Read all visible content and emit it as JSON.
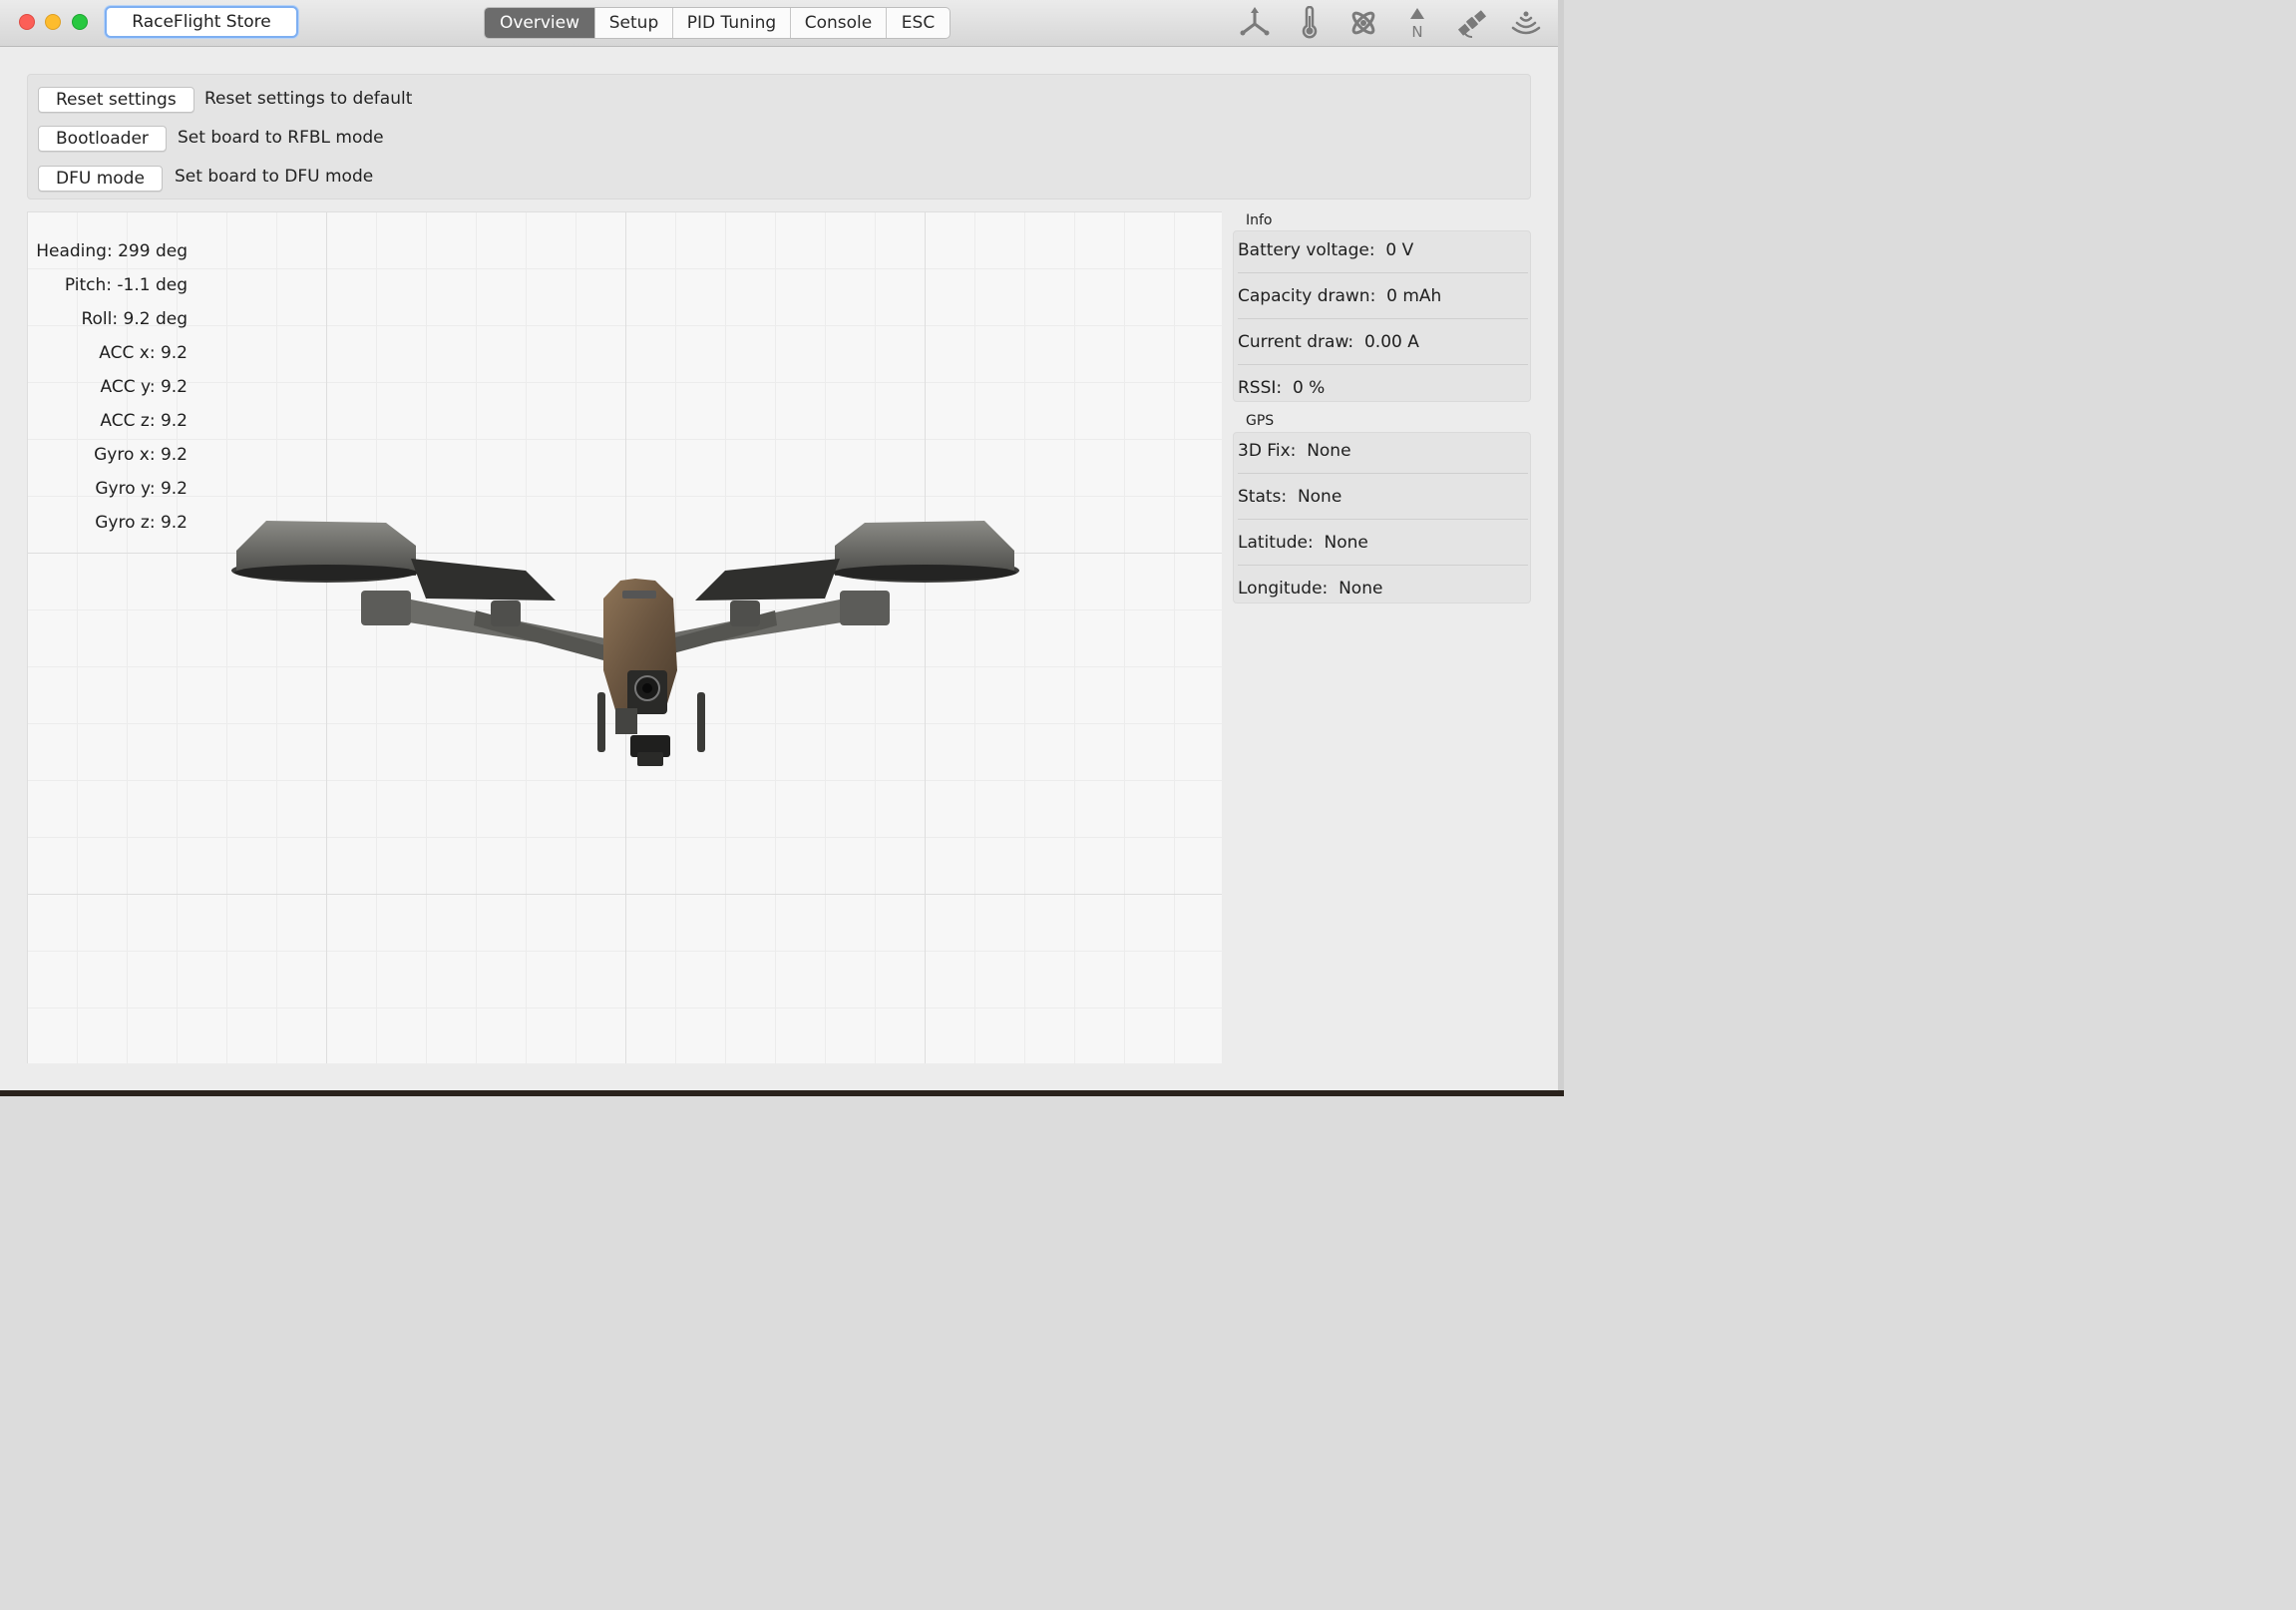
{
  "window": {
    "store_button": "RaceFlight Store",
    "tabs": [
      {
        "label": "Overview",
        "active": true
      },
      {
        "label": "Setup",
        "active": false
      },
      {
        "label": "PID Tuning",
        "active": false
      },
      {
        "label": "Console",
        "active": false
      },
      {
        "label": "ESC",
        "active": false
      }
    ],
    "toolbar_icons": [
      "axes-icon",
      "thermometer-icon",
      "gyro-icon",
      "compass-icon",
      "satellite-icon",
      "signal-icon"
    ],
    "compass_label": "N"
  },
  "commands": [
    {
      "button": "Reset settings",
      "description": "Reset settings to default"
    },
    {
      "button": "Bootloader",
      "description": "Set board to RFBL mode"
    },
    {
      "button": "DFU mode",
      "description": "Set board to DFU mode"
    }
  ],
  "readouts": [
    "Heading: 299 deg",
    "Pitch: -1.1 deg",
    "Roll: 9.2 deg",
    "ACC x: 9.2",
    "ACC y: 9.2",
    "ACC z: 9.2",
    "Gyro x: 9.2",
    "Gyro y: 9.2",
    "Gyro z: 9.2"
  ],
  "info": {
    "label": "Info",
    "rows": [
      {
        "label": "Battery voltage:",
        "value": "0 V"
      },
      {
        "label": "Capacity drawn:",
        "value": "0 mAh"
      },
      {
        "label": "Current draw:",
        "value": "0.00 A"
      },
      {
        "label": "RSSI:",
        "value": "0 %"
      }
    ]
  },
  "gps": {
    "label": "GPS",
    "rows": [
      {
        "label": "3D Fix:",
        "value": "None"
      },
      {
        "label": "Stats:",
        "value": "None"
      },
      {
        "label": "Latitude:",
        "value": "None"
      },
      {
        "label": "Longitude:",
        "value": "None"
      }
    ]
  },
  "colors": {
    "active_tab": "#6c6c6c",
    "focus_ring": "#7eaff2",
    "panel_bg": "#e4e4e4"
  }
}
